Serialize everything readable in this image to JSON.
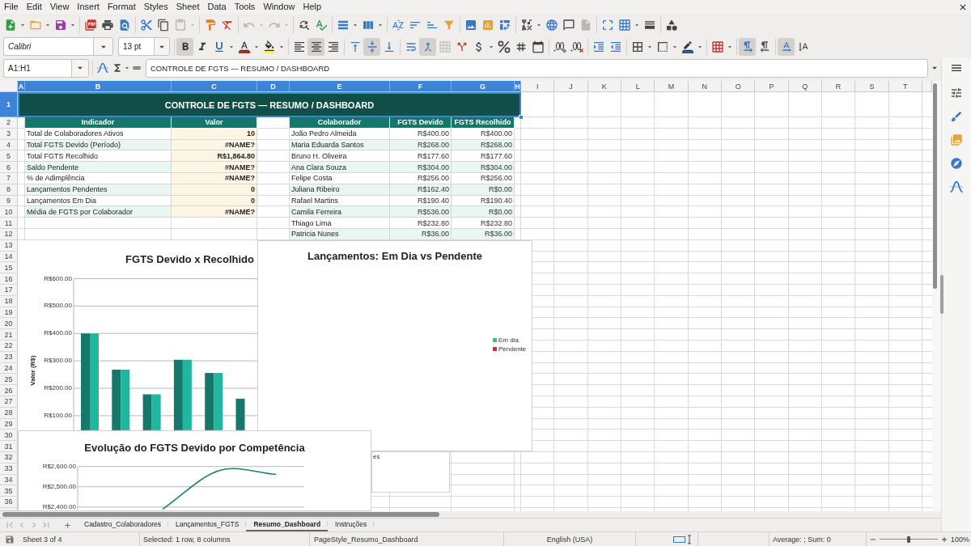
{
  "menu_bar": [
    "File",
    "Edit",
    "View",
    "Insert",
    "Format",
    "Styles",
    "Sheet",
    "Data",
    "Tools",
    "Window",
    "Help"
  ],
  "standard_toolbar": {
    "paste_disabled": true,
    "undo_disabled": true,
    "redo_disabled": true,
    "headers_footers_disabled": true
  },
  "format_toolbar": {
    "font_name": "Calibri",
    "font_size": "13 pt",
    "bold": true,
    "italic": false,
    "underline": false,
    "align_left": false,
    "align_center": true,
    "align_right": false,
    "align_top": false,
    "align_middle": true,
    "align_bottom": false,
    "wrap_text": false,
    "merge_and_center": true,
    "merge_cells_disabled": true,
    "left_to_right": true,
    "right_to_left": false,
    "text_horizontal": true,
    "text_vertical": false
  },
  "formula_bar": {
    "name_box": "A1:H1",
    "formula": "CONTROLE DE FGTS — RESUMO / DASHBOARD"
  },
  "sheet": {
    "column_headers": [
      {
        "label": "A",
        "selected": true
      },
      {
        "label": "B",
        "selected": true
      },
      {
        "label": "C",
        "selected": true
      },
      {
        "label": "D",
        "selected": true
      },
      {
        "label": "E",
        "selected": true
      },
      {
        "label": "F",
        "selected": true
      },
      {
        "label": "G",
        "selected": true
      },
      {
        "label": "H",
        "selected": true
      },
      {
        "label": "I",
        "selected": false
      },
      {
        "label": "J",
        "selected": false
      },
      {
        "label": "K",
        "selected": false
      },
      {
        "label": "L",
        "selected": false
      },
      {
        "label": "M",
        "selected": false
      },
      {
        "label": "N",
        "selected": false
      },
      {
        "label": "O",
        "selected": false
      },
      {
        "label": "P",
        "selected": false
      },
      {
        "label": "Q",
        "selected": false
      },
      {
        "label": "R",
        "selected": false
      },
      {
        "label": "S",
        "selected": false
      },
      {
        "label": "T",
        "selected": false
      }
    ],
    "row_headers": [
      {
        "label": "1",
        "selected": true
      },
      {
        "label": "2",
        "selected": false
      },
      {
        "label": "3",
        "selected": false
      },
      {
        "label": "4",
        "selected": false
      },
      {
        "label": "5",
        "selected": false
      },
      {
        "label": "6",
        "selected": false
      },
      {
        "label": "7",
        "selected": false
      },
      {
        "label": "8",
        "selected": false
      },
      {
        "label": "9",
        "selected": false
      },
      {
        "label": "10",
        "selected": false
      },
      {
        "label": "11",
        "selected": false
      },
      {
        "label": "12",
        "selected": false
      },
      {
        "label": "13",
        "selected": false
      },
      {
        "label": "14",
        "selected": false
      },
      {
        "label": "15",
        "selected": false
      },
      {
        "label": "16",
        "selected": false
      },
      {
        "label": "17",
        "selected": false
      },
      {
        "label": "18",
        "selected": false
      },
      {
        "label": "19",
        "selected": false
      },
      {
        "label": "20",
        "selected": false
      },
      {
        "label": "21",
        "selected": false
      },
      {
        "label": "22",
        "selected": false
      },
      {
        "label": "23",
        "selected": false
      },
      {
        "label": "24",
        "selected": false
      },
      {
        "label": "25",
        "selected": false
      },
      {
        "label": "26",
        "selected": false
      },
      {
        "label": "27",
        "selected": false
      },
      {
        "label": "28",
        "selected": false
      },
      {
        "label": "29",
        "selected": false
      },
      {
        "label": "30",
        "selected": false
      },
      {
        "label": "31",
        "selected": false
      },
      {
        "label": "32",
        "selected": false
      },
      {
        "label": "33",
        "selected": false
      },
      {
        "label": "34",
        "selected": false
      },
      {
        "label": "35",
        "selected": false
      },
      {
        "label": "36",
        "selected": false
      }
    ],
    "title": {
      "text": "CONTROLE DE FGTS — RESUMO / DASHBOARD",
      "selected": true
    },
    "summary": {
      "columns": [
        "Indicador",
        "Valor"
      ],
      "rows": [
        {
          "indicator": "Total de Colaboradores Ativos",
          "value": "10"
        },
        {
          "indicator": "Total FGTS Devido (Período)",
          "value": "#NAME?"
        },
        {
          "indicator": "Total FGTS Recolhido",
          "value": "R$1,864.80"
        },
        {
          "indicator": "Saldo Pendente",
          "value": "#NAME?"
        },
        {
          "indicator": "% de Adimplência",
          "value": "#NAME?"
        },
        {
          "indicator": "Lançamentos Pendentes",
          "value": "0"
        },
        {
          "indicator": "Lançamentos Em Dia",
          "value": "0"
        },
        {
          "indicator": "Média de FGTS por Colaborador",
          "value": "#NAME?"
        }
      ]
    },
    "employees": {
      "columns": [
        "Colaborador",
        "FGTS Devido",
        "FGTS Recolhido"
      ],
      "rows": [
        {
          "name": "João Pedro Almeida",
          "due": "R$400.00",
          "paid": "R$400.00"
        },
        {
          "name": "Maria Eduarda Santos",
          "due": "R$268.00",
          "paid": "R$268.00"
        },
        {
          "name": "Bruno H. Oliveira",
          "due": "R$177.60",
          "paid": "R$177.60"
        },
        {
          "name": "Ana Clara Souza",
          "due": "R$304.00",
          "paid": "R$304.00"
        },
        {
          "name": "Felipe Costa",
          "due": "R$256.00",
          "paid": "R$256.00"
        },
        {
          "name": "Juliana Ribeiro",
          "due": "R$162.40",
          "paid": "R$0.00"
        },
        {
          "name": "Rafael Martins",
          "due": "R$190.40",
          "paid": "R$190.40"
        },
        {
          "name": "Camila Ferreira",
          "due": "R$536.00",
          "paid": "R$0.00"
        },
        {
          "name": "Thiago Lima",
          "due": "R$232.80",
          "paid": "R$232.80"
        },
        {
          "name": "Patricia Nunes",
          "due": "R$36.00",
          "paid": "R$36.00"
        }
      ]
    }
  },
  "charts": [
    {
      "kind": "chart",
      "tick_prefixes": [
        "R$",
        "R$",
        "R$",
        "R$",
        "R$",
        "R$"
      ],
      "chart_data": {
        "type": "bar",
        "title": "FGTS Devido x Recolhido",
        "ylabel": "Valor (R$)",
        "ylim": [
          47,
          600
        ],
        "yticks": [
          {
            "value": 100,
            "label": "100.00"
          },
          {
            "value": 200,
            "label": "200.00"
          },
          {
            "value": 300,
            "label": "300.00"
          },
          {
            "value": 400,
            "label": "400.00"
          },
          {
            "value": 500,
            "label": "500.00"
          },
          {
            "value": 600,
            "label": "600.00"
          }
        ],
        "grid": true,
        "series": [
          {
            "color": "#17776b",
            "values": [
              400,
              268,
              178,
              304,
              256,
              162
            ]
          },
          {
            "color": "#20b79f",
            "values": [
              400,
              268,
              178,
              304,
              256
            ]
          }
        ]
      }
    },
    {
      "kind": "frame",
      "text": "es"
    },
    {
      "kind": "legend_chart",
      "title": "Lançamentos: Em Dia vs Pendente",
      "legend": [
        {
          "label": "Em dia",
          "color": "#2ecc71"
        },
        {
          "label": "Pendente",
          "color": "#d32f2f"
        }
      ]
    },
    {
      "kind": "chart",
      "tick_prefixes": [
        "R$",
        "R$",
        "R$"
      ],
      "chart_data": {
        "type": "line",
        "title": "Evolução do FGTS Devido por Competência",
        "ylim": [
          2385,
          2600
        ],
        "yticks": [
          {
            "value": 2400,
            "label": "2,400.00"
          },
          {
            "value": 2500,
            "label": "2,500.00"
          },
          {
            "value": 2600,
            "label": "2,600.00"
          }
        ],
        "grid": true,
        "series": [
          {
            "color": "#1f7f76",
            "values": [
              null,
              2390,
              2580,
              2561
            ]
          }
        ]
      }
    }
  ],
  "sheet_tabs": {
    "navigation_disabled": true,
    "tabs": [
      {
        "label": "Cadastro_Colaboradores",
        "selected": false
      },
      {
        "label": "Lançamentos_FGTS",
        "selected": false
      },
      {
        "label": "Resumo_Dashboard",
        "selected": true
      },
      {
        "label": "Instruções",
        "selected": false
      }
    ]
  },
  "status_bar": {
    "sheet": "Sheet 3 of 4",
    "selection": "Selected: 1 row, 8 columns",
    "page_style": "PageStyle_Resumo_Dashboard",
    "language": "English (USA)",
    "summary": "Average: ; Sum: 0",
    "zoom": {
      "level": 0.5,
      "reading": "100%"
    }
  }
}
